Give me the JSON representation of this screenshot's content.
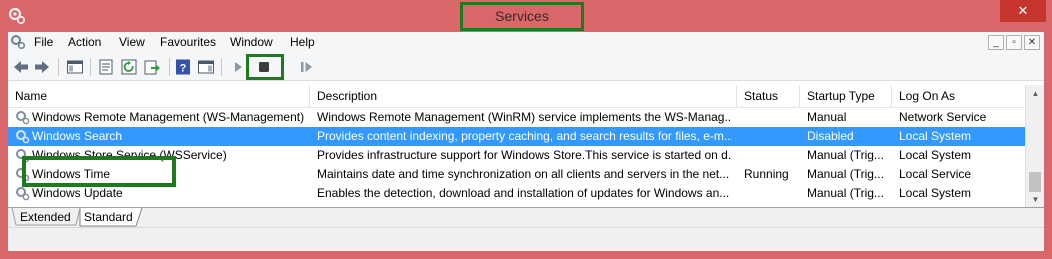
{
  "window": {
    "title": "Services",
    "close_label": "✕"
  },
  "menu": {
    "items": [
      "File",
      "Action",
      "View",
      "Favourites",
      "Window",
      "Help"
    ]
  },
  "mdi": {
    "minimize": "_",
    "restore": "▫",
    "close": "✕"
  },
  "columns": [
    "Name",
    "Description",
    "Status",
    "Startup Type",
    "Log On As"
  ],
  "rows": [
    {
      "name": "Windows Remote Management (WS-Management)",
      "description": "Windows Remote Management (WinRM) service implements the WS-Manag...",
      "status": "",
      "startup": "Manual",
      "logon": "Network Service"
    },
    {
      "name": "Windows Search",
      "description": "Provides content indexing, property caching, and search results for files, e-m...",
      "status": "",
      "startup": "Disabled",
      "logon": "Local System"
    },
    {
      "name": "Windows Store Service (WSService)",
      "description": "Provides infrastructure support for Windows Store.This service is started on d...",
      "status": "",
      "startup": "Manual (Trig...",
      "logon": "Local System"
    },
    {
      "name": "Windows Time",
      "description": "Maintains date and time synchronization on all clients and servers in the net...",
      "status": "Running",
      "startup": "Manual (Trig...",
      "logon": "Local Service"
    },
    {
      "name": "Windows Update",
      "description": "Enables the detection, download and installation of updates for Windows an...",
      "status": "",
      "startup": "Manual (Trig...",
      "logon": "Local System"
    }
  ],
  "selected_row": "Windows Search",
  "tabs": {
    "extended": "Extended",
    "standard": "Standard",
    "active": "Standard"
  },
  "toolbar": {
    "buttons": [
      "back-icon",
      "forward-icon",
      "show-hide-console-tree-icon",
      "properties-icon",
      "refresh-icon",
      "export-list-icon",
      "help-icon",
      "action-pane-icon",
      "start-service-icon",
      "stop-service-icon",
      "pause-service-icon",
      "restart-service-icon"
    ]
  },
  "colors": {
    "title_bar": "#d9676a",
    "close_button": "#c7352f",
    "selection": "#3399ff",
    "highlight_box": "#1f7a1f"
  }
}
